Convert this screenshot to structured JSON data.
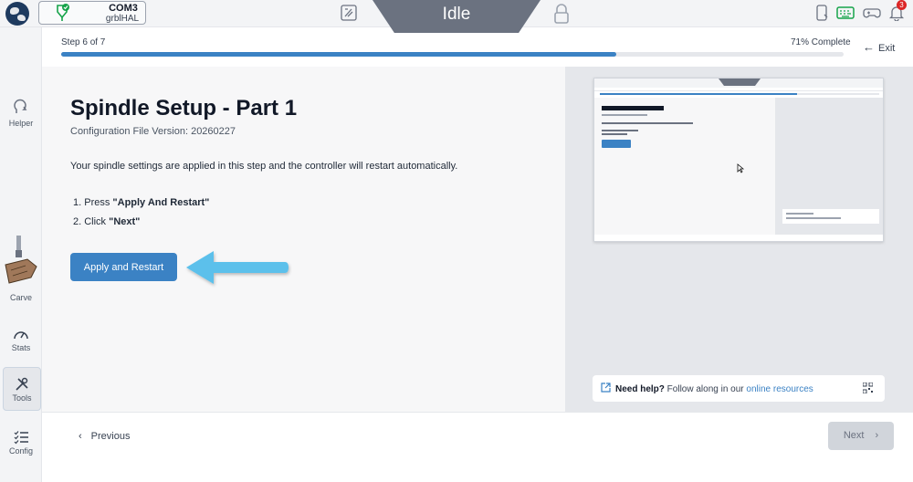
{
  "topbar": {
    "port_name": "COM3",
    "firmware": "grblHAL",
    "status": "Idle",
    "notification_count": "3"
  },
  "sidebar": {
    "items": [
      {
        "label": "Helper",
        "icon": "helper-icon"
      },
      {
        "label": "Carve",
        "icon": "carve-icon"
      },
      {
        "label": "Stats",
        "icon": "gauge-icon"
      },
      {
        "label": "Tools",
        "icon": "tools-icon"
      },
      {
        "label": "Config",
        "icon": "checklist-icon"
      }
    ],
    "active": "Tools"
  },
  "progress": {
    "step_label": "Step 6 of 7",
    "percent_label": "71% Complete",
    "fraction": 0.71,
    "exit_label": "Exit"
  },
  "main": {
    "title": "Spindle Setup - Part 1",
    "subtitle": "Configuration File Version: 20260227",
    "description": "Your spindle settings are applied in this step and the controller will restart automatically.",
    "steps": [
      {
        "prefix": "1. Press ",
        "bold": "\"Apply And Restart\""
      },
      {
        "prefix": "2. Click ",
        "bold": "\"Next\""
      }
    ],
    "apply_button": "Apply and Restart"
  },
  "help": {
    "bold": "Need help?",
    "text": " Follow along in our ",
    "link": "online resources"
  },
  "footer": {
    "previous_label": "Previous",
    "next_label": "Next"
  },
  "colors": {
    "accent": "#3b82c4",
    "status_bg": "#6b7280",
    "arrow": "#5bc0eb"
  }
}
